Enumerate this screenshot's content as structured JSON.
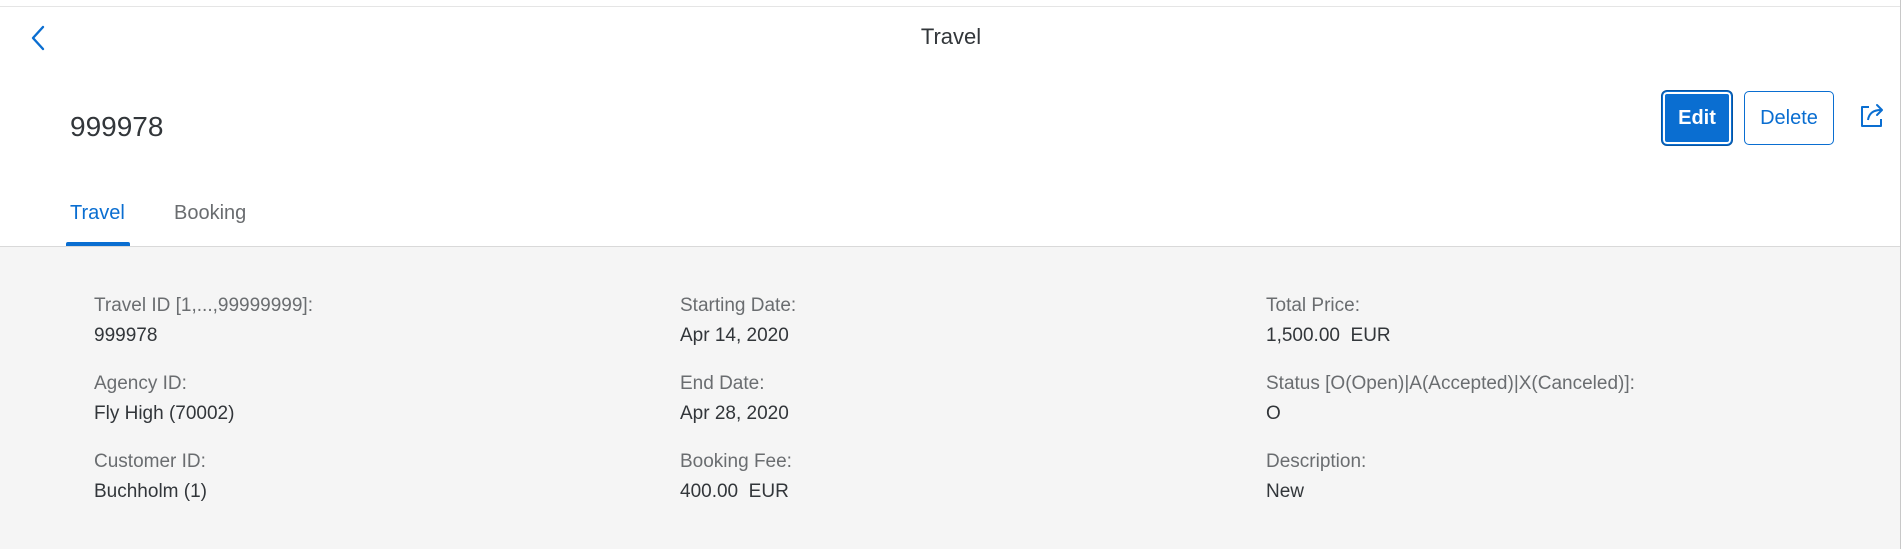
{
  "shell": {
    "title": "Travel"
  },
  "header": {
    "object_title": "999978",
    "edit_label": "Edit",
    "delete_label": "Delete"
  },
  "tabs": [
    {
      "label": "Travel",
      "selected": true
    },
    {
      "label": "Booking",
      "selected": false
    }
  ],
  "fields": {
    "travel_id": {
      "label": "Travel ID [1,...,99999999]:",
      "value": "999978"
    },
    "agency_id": {
      "label": "Agency ID:",
      "value": "Fly High (70002)"
    },
    "customer_id": {
      "label": "Customer ID:",
      "value": "Buchholm (1)"
    },
    "starting_date": {
      "label": "Starting Date:",
      "value": "Apr 14, 2020"
    },
    "end_date": {
      "label": "End Date:",
      "value": "Apr 28, 2020"
    },
    "booking_fee": {
      "label": "Booking Fee:",
      "value": "400.00  EUR"
    },
    "total_price": {
      "label": "Total Price:",
      "value": "1,500.00  EUR"
    },
    "status": {
      "label": "Status [O(Open)|A(Accepted)|X(Canceled)]:",
      "value": "O"
    },
    "description": {
      "label": "Description:",
      "value": "New"
    }
  },
  "colors": {
    "accent": "#0a6ed1",
    "text": "#32363a",
    "label": "#6a6d70",
    "content_bg": "#f5f5f5"
  },
  "icons": {
    "back": "chevron-left-icon",
    "share": "share-icon"
  }
}
